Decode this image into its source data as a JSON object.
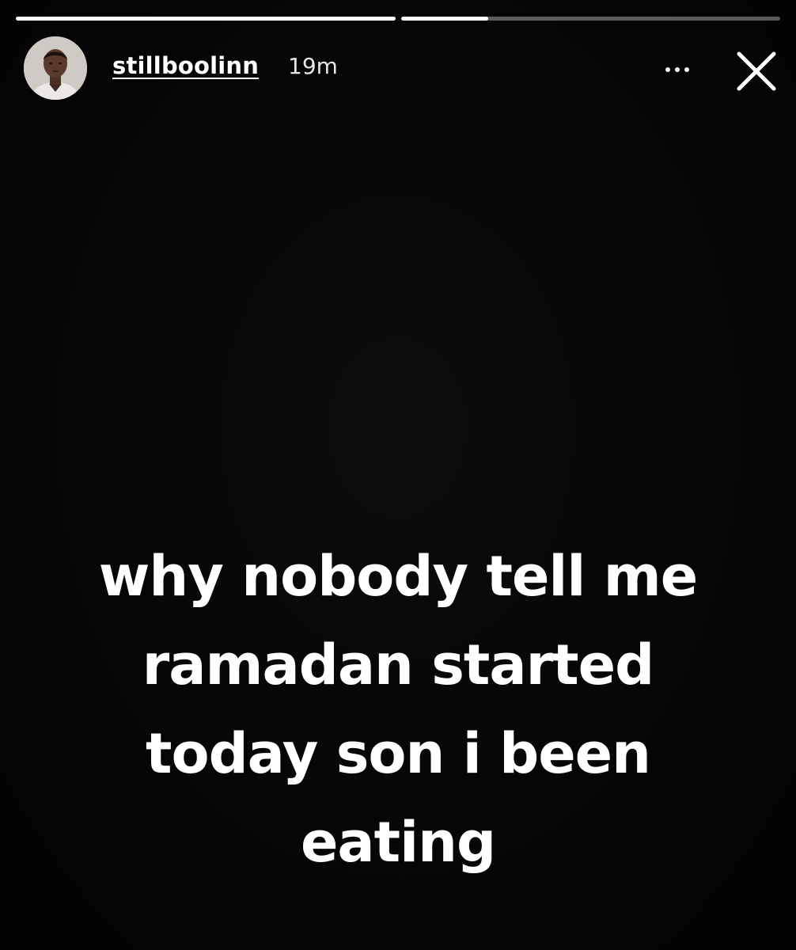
{
  "story": {
    "username": "stillboolinn",
    "timestamp": "19m",
    "progress": [
      1.0,
      0.23
    ],
    "caption_lines": [
      "why nobody tell me",
      "ramadan started",
      "today son i been",
      "eating"
    ]
  },
  "icons": {
    "more": "more-options-icon",
    "close": "close-icon",
    "avatar": "profile-photo"
  },
  "colors": {
    "background": "#000000",
    "text": "#ffffff",
    "progress_track": "rgba(255,255,255,0.35)",
    "progress_fill": "#ffffff"
  }
}
